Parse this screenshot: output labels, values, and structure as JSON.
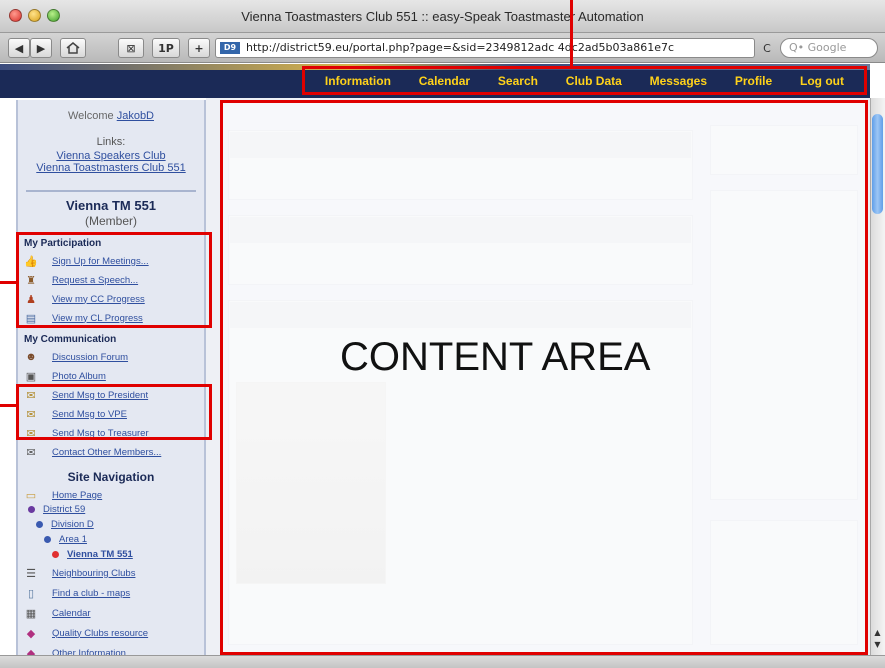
{
  "window": {
    "title": "Vienna Toastmasters Club 551 :: easy-Speak Toastmaster Automation"
  },
  "toolbar": {
    "back_icon": "back-arrow-icon",
    "forward_icon": "forward-arrow-icon",
    "home_icon": "home-icon",
    "stop_icon": "stop-icon",
    "pr_label": "1P",
    "add_icon": "plus-icon",
    "url": "http://district59.eu/portal.php?page=&sid=2349812adc 4dc2ad5b03a861e7c",
    "reload_label": "C",
    "search_placeholder": "Q• Google"
  },
  "nav": {
    "items": [
      "Information",
      "Calendar",
      "Search",
      "Club Data",
      "Messages",
      "Profile",
      "Log out"
    ]
  },
  "sidebar": {
    "welcome_prefix": "Welcome",
    "username": "JakobD",
    "links_label": "Links:",
    "links": [
      "Vienna Speakers Club",
      "Vienna Toastmasters Club 551"
    ],
    "club_name": "Vienna TM 551",
    "role": "(Member)",
    "participation_title": "My Participation",
    "participation": [
      "Sign Up for Meetings...",
      "Request a Speech...",
      "View my CC Progress",
      "View my CL Progress"
    ],
    "communication_title": "My Communication",
    "communication": [
      "Discussion Forum",
      "Photo Album",
      "Send Msg to President",
      "Send Msg to VPE",
      "Send Msg to Treasurer",
      "Contact Other Members..."
    ],
    "site_nav_title": "Site Navigation",
    "tree": [
      "Home Page",
      "District 59",
      "Division D",
      "Area 1",
      "Vienna TM 551"
    ],
    "more": [
      "Neighbouring Clubs",
      "Find a club - maps",
      "Calendar",
      "Quality Clubs resource",
      "Other Information"
    ]
  },
  "content": {
    "label": "CONTENT AREA"
  },
  "colors": {
    "highlight": "#e00000",
    "header_bg": "#1b2a57",
    "nav_text": "#ffd21a",
    "link": "#2f4f9f",
    "scroll_thumb": "#5f9ee8"
  }
}
